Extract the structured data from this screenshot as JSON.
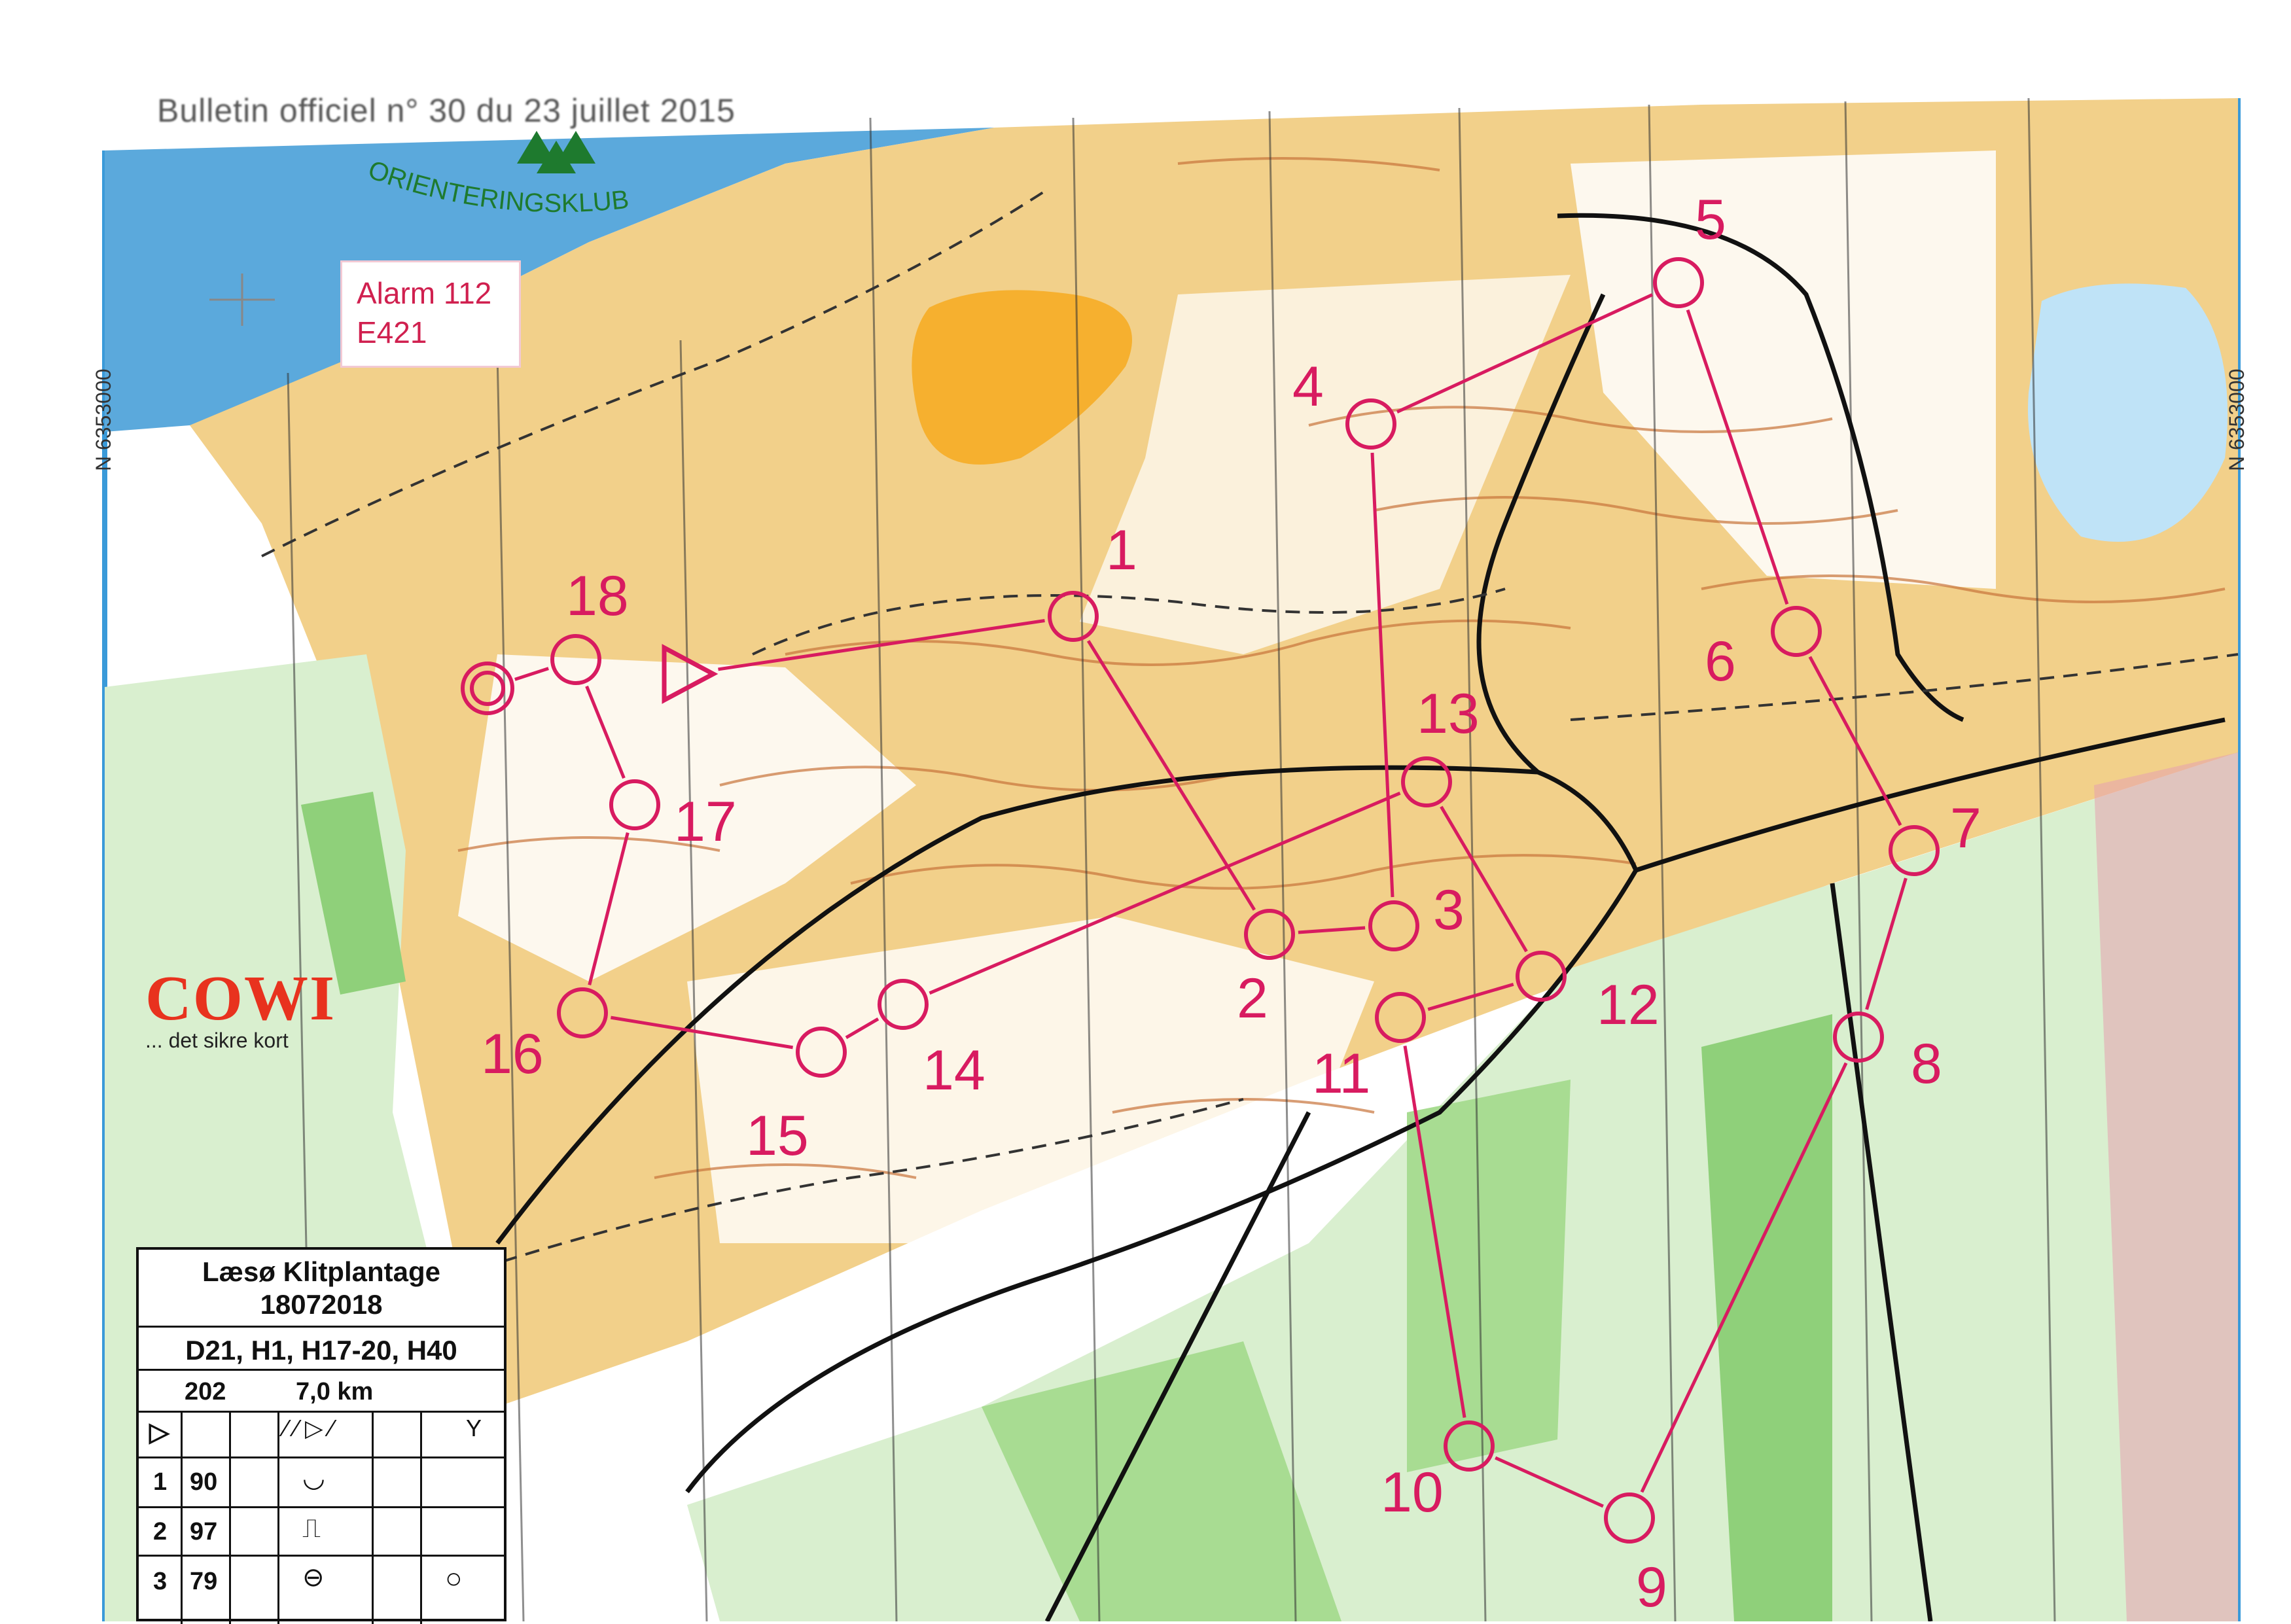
{
  "header": {
    "bulletin": "Bulletin officiel n° 30 du 23 juillet 2015"
  },
  "club": {
    "arc_text": "ORIENTERINGSKLUB"
  },
  "alarm": {
    "line1": "Alarm 112",
    "line2": "E421"
  },
  "sponsor": {
    "name": "COWI",
    "tagline": "... det sikre kort"
  },
  "grid": {
    "northing_left": "N 6353000",
    "northing_right": "N 6353000"
  },
  "legend": {
    "title": "Læsø Klitplantage",
    "date": "18072018",
    "classes": "D21, H1, H17-20, H40",
    "course_number": "202",
    "length": "7,0 km",
    "rows": [
      {
        "n": "1",
        "code": "90"
      },
      {
        "n": "2",
        "code": "97"
      },
      {
        "n": "3",
        "code": "79"
      }
    ]
  },
  "course": {
    "color": "#d81b60",
    "controls": [
      {
        "label": "1"
      },
      {
        "label": "2"
      },
      {
        "label": "3"
      },
      {
        "label": "4"
      },
      {
        "label": "5"
      },
      {
        "label": "6"
      },
      {
        "label": "7"
      },
      {
        "label": "8"
      },
      {
        "label": "9"
      },
      {
        "label": "10"
      },
      {
        "label": "11"
      },
      {
        "label": "12"
      },
      {
        "label": "13"
      },
      {
        "label": "14"
      },
      {
        "label": "15"
      },
      {
        "label": "16"
      },
      {
        "label": "17"
      },
      {
        "label": "18"
      }
    ]
  },
  "colors": {
    "sea": "#5ba9dc",
    "sand": "#f2d08a",
    "open": "#f6c35c",
    "forest": "#ffffff",
    "green": "#8fd07a",
    "contour": "#c8743a",
    "course": "#d81b60",
    "frame": "#3a9ad9"
  }
}
